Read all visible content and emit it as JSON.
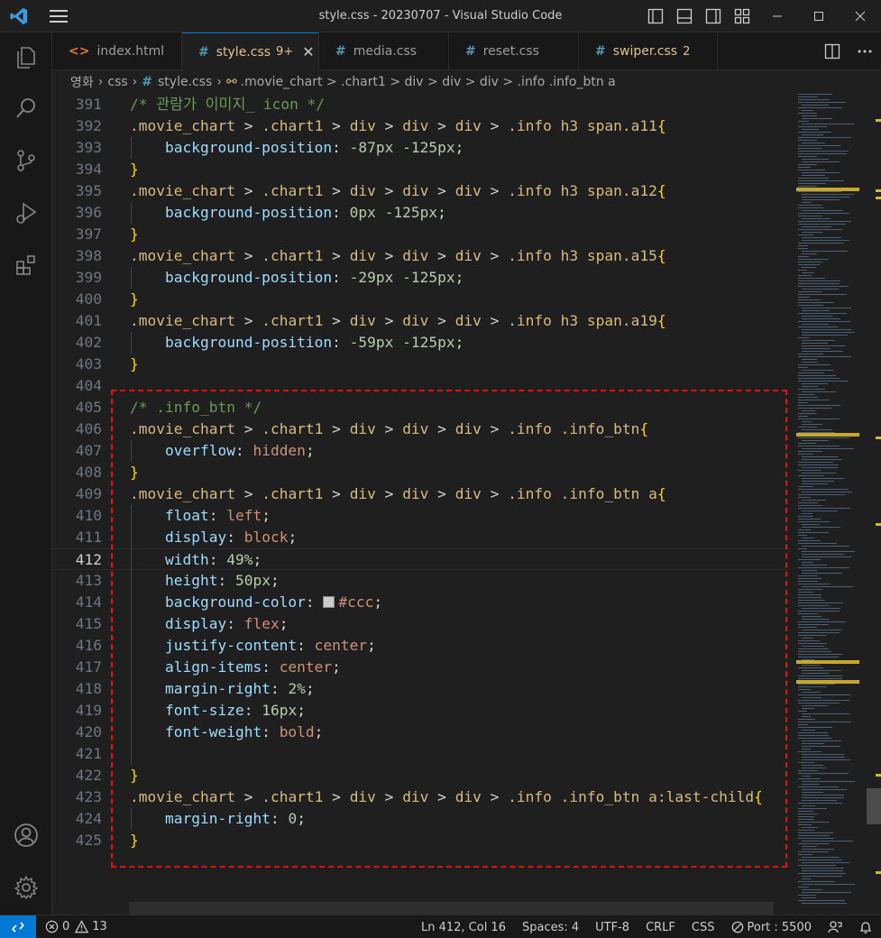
{
  "window": {
    "title": "style.css - 20230707 - Visual Studio Code"
  },
  "tabs": [
    {
      "label": "index.html",
      "icon": "<>",
      "icon_color": "#e37933",
      "badge": "",
      "active": false
    },
    {
      "label": "style.css",
      "icon": "#",
      "icon_color": "#519aba",
      "badge": "9+",
      "active": true
    },
    {
      "label": "media.css",
      "icon": "#",
      "icon_color": "#519aba",
      "badge": "",
      "active": false
    },
    {
      "label": "reset.css",
      "icon": "#",
      "icon_color": "#519aba",
      "badge": "",
      "active": false
    },
    {
      "label": "swiper.css",
      "icon": "#",
      "icon_color": "#519aba",
      "badge": "2",
      "active": false
    }
  ],
  "breadcrumb": {
    "items": [
      "영화",
      "css",
      "style.css",
      ".movie_chart > .chart1 > div > div > div > .info .info_btn a"
    ]
  },
  "editor": {
    "current_line": "412",
    "lines": [
      {
        "n": "391",
        "comment": "/* 관람가 이미지_ icon */"
      },
      {
        "n": "392",
        "selector": ".movie_chart > .chart1 > div > div > div > .info h3 span.a11",
        "brace": "{"
      },
      {
        "n": "393",
        "prop": "background-position",
        "value": "-87px -125px",
        "vclass": "num"
      },
      {
        "n": "394",
        "brace": "}"
      },
      {
        "n": "395",
        "selector": ".movie_chart > .chart1 > div > div > div > .info h3 span.a12",
        "brace": "{"
      },
      {
        "n": "396",
        "prop": "background-position",
        "value": "0px -125px",
        "vclass": "num"
      },
      {
        "n": "397",
        "brace": "}"
      },
      {
        "n": "398",
        "selector": ".movie_chart > .chart1 > div > div > div > .info h3 span.a15",
        "brace": "{"
      },
      {
        "n": "399",
        "prop": "background-position",
        "value": "-29px -125px",
        "vclass": "num"
      },
      {
        "n": "400",
        "brace": "}"
      },
      {
        "n": "401",
        "selector": ".movie_chart > .chart1 > div > div > div > .info h3 span.a19",
        "brace": "{"
      },
      {
        "n": "402",
        "prop": "background-position",
        "value": "-59px -125px",
        "vclass": "num"
      },
      {
        "n": "403",
        "brace": "}"
      },
      {
        "n": "404"
      },
      {
        "n": "405",
        "comment": "/* .info_btn */"
      },
      {
        "n": "406",
        "selector": ".movie_chart > .chart1 > div > div > div > .info .info_btn",
        "brace": "{"
      },
      {
        "n": "407",
        "prop": "overflow",
        "value": "hidden",
        "vclass": "val"
      },
      {
        "n": "408",
        "brace": "}"
      },
      {
        "n": "409",
        "selector": ".movie_chart > .chart1 > div > div > div > .info .info_btn a",
        "brace": "{"
      },
      {
        "n": "410",
        "prop": "float",
        "value": "left",
        "vclass": "val"
      },
      {
        "n": "411",
        "prop": "display",
        "value": "block",
        "vclass": "val"
      },
      {
        "n": "412",
        "prop": "width",
        "value": "49%",
        "vclass": "num"
      },
      {
        "n": "413",
        "prop": "height",
        "value": "50px",
        "vclass": "num"
      },
      {
        "n": "414",
        "prop": "background-color",
        "value": "#ccc",
        "vclass": "val",
        "swatch": "#cccccc"
      },
      {
        "n": "415",
        "prop": "display",
        "value": "flex",
        "vclass": "val"
      },
      {
        "n": "416",
        "prop": "justify-content",
        "value": "center",
        "vclass": "val"
      },
      {
        "n": "417",
        "prop": "align-items",
        "value": "center",
        "vclass": "val"
      },
      {
        "n": "418",
        "prop": "margin-right",
        "value": "2%",
        "vclass": "num"
      },
      {
        "n": "419",
        "prop": "font-size",
        "value": "16px",
        "vclass": "num"
      },
      {
        "n": "420",
        "prop": "font-weight",
        "value": "bold",
        "vclass": "val"
      },
      {
        "n": "421"
      },
      {
        "n": "422",
        "brace": "}"
      },
      {
        "n": "423",
        "selector": ".movie_chart > .chart1 > div > div > div > .info .info_btn a:last-child",
        "brace": "{"
      },
      {
        "n": "424",
        "prop": "margin-right",
        "value": "0",
        "vclass": "num"
      },
      {
        "n": "425",
        "brace": "}"
      }
    ]
  },
  "statusbar": {
    "errors": "0",
    "warnings": "13",
    "position": "Ln 412, Col 16",
    "spaces": "Spaces: 4",
    "encoding": "UTF-8",
    "eol": "CRLF",
    "language": "CSS",
    "port": "Port : 5500"
  },
  "colors": {
    "accent": "#0078d4",
    "annotation": "#e01010"
  }
}
